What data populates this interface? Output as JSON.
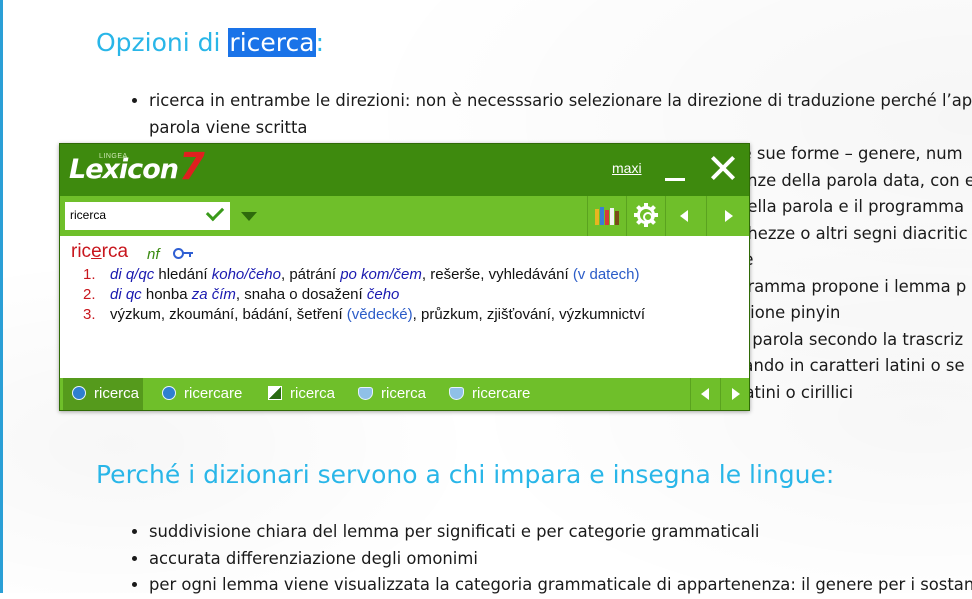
{
  "page": {
    "heading1_prefix": "Opzioni di ",
    "heading1_highlight": "ricerca",
    "heading1_suffix": ":",
    "list1": [
      "ricerca in entrambe le direzioni: non è necesssario selezionare la direzione di traduzione perché l’app",
      "parola viene scritta",
      "le sue forme – genere, num",
      "enze della parola data, con e",
      "della parola e il programma",
      "ghezze o altri segni diacritic",
      "re",
      "gramma propone i lemma p",
      "izione pinyin",
      "a parola secondo la trascriz",
      "tando in caratteri latini o se",
      "nel dizionario serbo-italiano è possibile ricercare una parola in caratteri latini o cirillici"
    ],
    "heading2": "Perché i dizionari servono a chi impara e insegna le lingue:",
    "list2": [
      "suddivisione chiara del lemma per significati e per categorie grammaticali",
      "accurata differenziazione degli omonimi",
      "per ogni lemma viene visualizzata la categoria grammaticale di appartenenza: il genere per i sostant"
    ]
  },
  "popup": {
    "logo_sub": "LINGEA",
    "logo_main": "Lexicon",
    "logo_num": "7",
    "maxi_label": "maxi",
    "search_value": "ricerca",
    "headword_a": "ric",
    "headword_u": "e",
    "headword_b": "rca",
    "pos": "nf",
    "senses": [
      {
        "num": "1.",
        "parts": [
          "di q/qc",
          " hledání ",
          "koho/čeho",
          ", pátrání ",
          "po kom/čem",
          ", rešerše, vyhledávání ",
          "(v datech)"
        ]
      },
      {
        "num": "2.",
        "parts": [
          "di qc",
          " honba ",
          "za čím",
          ", snaha o dosažení ",
          "čeho"
        ]
      },
      {
        "num": "3.",
        "parts": [
          "výzkum, zkoumání, bádání, šetření ",
          "(vědecké)",
          ", průzkum, zjišťování, výzkumnictví"
        ]
      }
    ],
    "history": [
      "ricerca",
      "ricercare",
      "ricerca",
      "ricerca",
      "ricercare"
    ],
    "colors": {
      "title": "#3e8a0e",
      "toolbar": "#6fbf2a",
      "headword": "#c8161d",
      "accent_blue": "#1a1ab0"
    }
  }
}
